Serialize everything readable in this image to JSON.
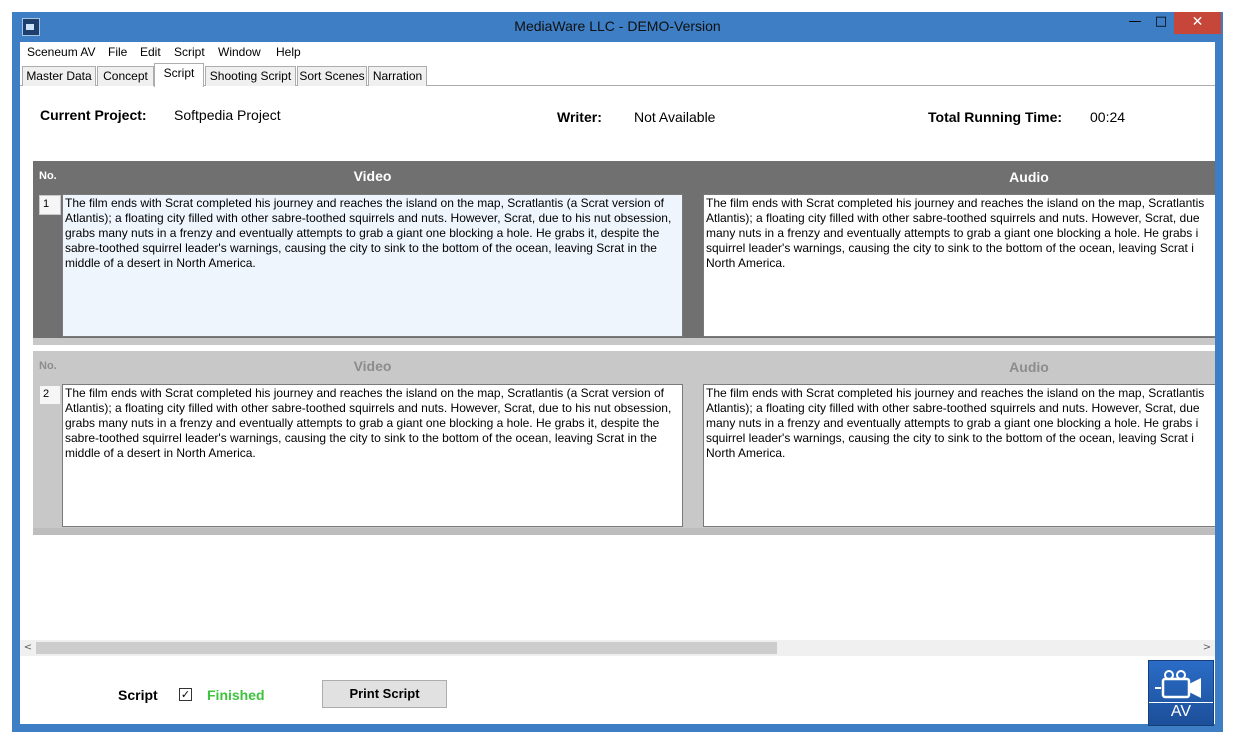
{
  "window": {
    "title": "MediaWare LLC - DEMO-Version",
    "minimize": "—",
    "maximize": "□",
    "close": "✕"
  },
  "menu": [
    "Sceneum AV",
    "File",
    "Edit",
    "Script",
    "Window",
    "Help"
  ],
  "tabs": [
    "Master Data",
    "Concept",
    "Script",
    "Shooting Script",
    "Sort Scenes",
    "Narration"
  ],
  "active_tab": "Script",
  "project": {
    "current_label": "Current Project:",
    "current_value": "Softpedia Project",
    "writer_label": "Writer:",
    "writer_value": "Not Available",
    "running_label": "Total Running Time:",
    "running_value": "00:24"
  },
  "scenes": [
    {
      "no_label": "No.",
      "number": "1",
      "video_header": "Video",
      "audio_header": "Audio",
      "video_text": "The film ends with Scrat completed his journey and reaches the island on the map, Scratlantis (a Scrat version of Atlantis); a floating city filled with other sabre-toothed squirrels and nuts. However, Scrat, due to his nut obsession, grabs many nuts in a frenzy and eventually attempts to grab a giant one blocking a hole. He grabs it, despite the sabre-toothed squirrel leader's warnings, causing the city to sink to the bottom of the ocean, leaving Scrat in the middle of a desert in North America.",
      "audio_lines": [
        "The film ends with Scrat completed his journey and reaches the island on the map, Scratlantis",
        "Atlantis); a floating city filled with other sabre-toothed squirrels and nuts. However, Scrat, due",
        "many nuts in a frenzy and eventually attempts to grab a giant one blocking a hole. He grabs i",
        "squirrel leader's warnings, causing the city to sink to the bottom of the ocean, leaving Scrat i",
        "North America."
      ]
    },
    {
      "no_label": "No.",
      "number": "2",
      "video_header": "Video",
      "audio_header": "Audio",
      "video_text": "The film ends with Scrat completed his journey and reaches the island on the map, Scratlantis (a Scrat version of Atlantis); a floating city filled with other sabre-toothed squirrels and nuts. However, Scrat, due to his nut obsession, grabs many nuts in a frenzy and eventually attempts to grab a giant one blocking a hole. He grabs it, despite the sabre-toothed squirrel leader's warnings, causing the city to sink to the bottom of the ocean, leaving Scrat in the middle of a desert in North America.",
      "audio_lines": [
        "The film ends with Scrat completed his journey and reaches the island on the map, Scratlantis",
        "Atlantis); a floating city filled with other sabre-toothed squirrels and nuts. However, Scrat, due",
        "many nuts in a frenzy and eventually attempts to grab a giant one blocking a hole. He grabs i",
        "squirrel leader's warnings, causing the city to sink to the bottom of the ocean, leaving Scrat i",
        "North America."
      ]
    }
  ],
  "scroll": {
    "left_arrow": "<",
    "right_arrow": ">"
  },
  "footer": {
    "script_label": "Script",
    "checked": true,
    "checkmark": "✓",
    "finished_label": "Finished",
    "print_button": "Print Script"
  },
  "logo": {
    "text": "AV",
    "icon": "video-camera-icon"
  },
  "colors": {
    "titlebar": "#3d7ec4",
    "close_button": "#c7463a",
    "scene_active": "#707070",
    "scene_inactive": "#c8c8c8",
    "finished": "#3cc43c"
  }
}
